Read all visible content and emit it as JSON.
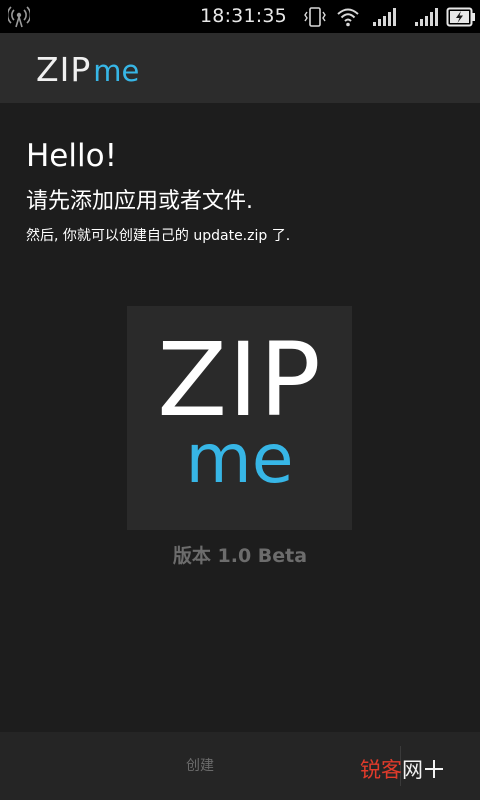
{
  "status_bar": {
    "time": "18:31:35",
    "icons": [
      "antenna-icon",
      "vibrate-icon",
      "wifi-icon",
      "signal-icon",
      "signal-icon",
      "battery-charging-icon"
    ]
  },
  "action_bar": {
    "logo_zip": "ZIP",
    "logo_me": "me"
  },
  "content": {
    "hello": "Hello!",
    "subtitle": "请先添加应用或者文件.",
    "note": "然后, 你就可以创建自己的 update.zip 了.",
    "logo_zip": "ZIP",
    "logo_me": "me",
    "version": "版本 1.0 Beta"
  },
  "bottom_bar": {
    "create_label": "创建"
  },
  "watermark": {
    "part1": "锐客",
    "part2": "网"
  },
  "colors": {
    "accent": "#37b6e6",
    "background": "#1d1d1d",
    "action_bar": "#2c2c2c",
    "watermark_red": "#e03b2b"
  }
}
